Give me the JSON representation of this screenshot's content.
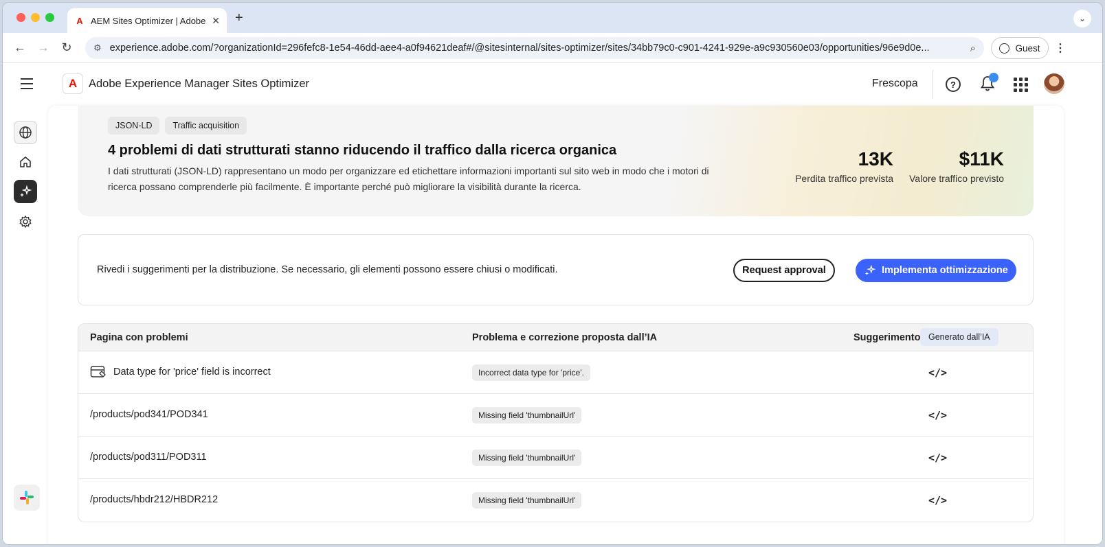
{
  "browser": {
    "tab_title": "AEM Sites Optimizer | Adobe",
    "url": "experience.adobe.com/?organizationId=296fefc8-1e54-46dd-aee4-a0f94621deaf#/@sitesinternal/sites-optimizer/sites/34bb79c0-c901-4241-929e-a9c930560e03/opportunities/96e9d0e...",
    "profile_label": "Guest"
  },
  "header": {
    "app_title": "Adobe Experience Manager Sites Optimizer",
    "org_name": "Frescopa"
  },
  "hero": {
    "tags": [
      "JSON-LD",
      "Traffic acquisition"
    ],
    "title": "4 problemi di dati strutturati stanno riducendo il traffico dalla ricerca organica",
    "description": "I dati strutturati (JSON-LD) rappresentano un modo per organizzare ed etichettare informazioni importanti sul sito web in modo che i motori di ricerca possano comprenderle più facilmente. È importante perché può migliorare la visibilità durante la ricerca.",
    "metrics": [
      {
        "value": "13K",
        "label": "Perdita traffico prevista"
      },
      {
        "value": "$11K",
        "label": "Valore traffico previsto"
      }
    ]
  },
  "actions": {
    "message": "Rivedi i suggerimenti per la distribuzione. Se necessario, gli elementi possono essere chiusi o modificati.",
    "request_approval": "Request approval",
    "implement": "Implementa ottimizzazione"
  },
  "table": {
    "headers": {
      "page": "Pagina con problemi",
      "issue": "Problema e correzione proposta dall’IA",
      "suggestion": "Suggerimento",
      "ai_badge": "Generato dall’IA"
    },
    "rows": [
      {
        "page": "Data type for 'price' field is incorrect",
        "issue": "Incorrect data type for 'price'."
      },
      {
        "page": "/products/pod341/POD341",
        "issue": "Missing field 'thumbnailUrl'"
      },
      {
        "page": "/products/pod311/POD311",
        "issue": "Missing field 'thumbnailUrl'"
      },
      {
        "page": "/products/hbdr212/HBDR212",
        "issue": "Missing field 'thumbnailUrl'"
      }
    ]
  },
  "colors": {
    "primary_button": "#3b63fb",
    "adobe_red": "#eb1000",
    "notification_dot": "#378ef0"
  }
}
